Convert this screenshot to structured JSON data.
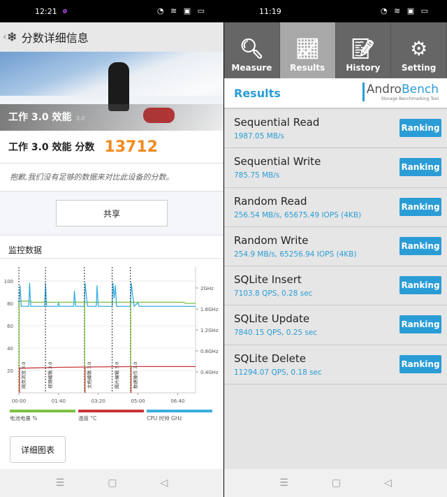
{
  "left": {
    "status": {
      "time": "12:21"
    },
    "appbar": {
      "title": "分数详细信息"
    },
    "hero": {
      "title": "工作 3.0 效能",
      "version": "3.0"
    },
    "score": {
      "label": "工作 3.0 效能 分数",
      "value": "13712"
    },
    "note": "抱歉,我们没有足够的数据来对比此设备的分数。",
    "share_label": "共享",
    "monitor_title": "监控数据",
    "detail_label": "详细图表",
    "chart_data": {
      "type": "line",
      "x_ticks": [
        "00:00",
        "01:40",
        "03:20",
        "05:00",
        "06:40"
      ],
      "y_ticks": [
        20,
        40,
        60,
        80,
        100
      ],
      "y2_ticks": [
        "0.4GHz",
        "0.8GHz",
        "1.2GHz",
        "1.6GHz",
        "2GHz"
      ],
      "markers": [
        {
          "x": "00:00",
          "label": "网页浏览 3.0"
        },
        {
          "x": "01:07",
          "label": "视频编辑 3.0"
        },
        {
          "x": "02:45",
          "label": "文档编辑 3.0"
        },
        {
          "x": "03:55",
          "label": "图片编辑 3.0"
        },
        {
          "x": "04:41",
          "label": "数据操作 3.0"
        }
      ],
      "series": [
        {
          "name": "电池电量 %",
          "color": "#7cc143",
          "points": [
            [
              "00:00",
              82
            ],
            [
              "00:30",
              82
            ],
            [
              "00:32",
              81
            ],
            [
              "06:55",
              81
            ],
            [
              "07:00",
              80
            ],
            [
              "07:25",
              80
            ]
          ]
        },
        {
          "name": "温度 °C",
          "color": "#c8363a",
          "points": [
            [
              "00:00",
              22
            ],
            [
              "01:40",
              22.8
            ],
            [
              "03:20",
              23.2
            ],
            [
              "05:00",
              23.5
            ],
            [
              "07:25",
              23.5
            ]
          ]
        },
        {
          "name": "CPU 时钟 GHz",
          "color": "#3aaee0",
          "points": [
            [
              "00:00",
              1.65
            ],
            [
              "00:03",
              2.05
            ],
            [
              "00:06",
              1.65
            ],
            [
              "00:25",
              1.65
            ],
            [
              "00:27",
              2.1
            ],
            [
              "00:30",
              1.65
            ],
            [
              "01:05",
              1.65
            ],
            [
              "01:07",
              2.1
            ],
            [
              "01:10",
              1.65
            ],
            [
              "01:38",
              1.65
            ],
            [
              "01:40",
              1.72
            ],
            [
              "01:42",
              1.65
            ],
            [
              "02:18",
              1.65
            ],
            [
              "02:20",
              1.95
            ],
            [
              "02:23",
              1.65
            ],
            [
              "02:45",
              1.65
            ],
            [
              "02:47",
              2.1
            ],
            [
              "02:50",
              1.85
            ],
            [
              "02:53",
              1.65
            ],
            [
              "03:15",
              1.65
            ],
            [
              "03:17",
              2.05
            ],
            [
              "03:20",
              1.65
            ],
            [
              "03:55",
              1.65
            ],
            [
              "03:57",
              2.1
            ],
            [
              "04:00",
              1.8
            ],
            [
              "04:03",
              2.05
            ],
            [
              "04:06",
              1.65
            ],
            [
              "04:41",
              1.65
            ],
            [
              "04:43",
              2.1
            ],
            [
              "04:46",
              1.9
            ],
            [
              "04:50",
              1.65
            ],
            [
              "05:00",
              1.72
            ],
            [
              "05:03",
              1.65
            ],
            [
              "07:25",
              1.65
            ]
          ]
        }
      ]
    }
  },
  "right": {
    "status": {
      "time": "11:19"
    },
    "tabs": [
      {
        "label": "Measure",
        "icon": "search-icon"
      },
      {
        "label": "Results",
        "icon": "chart-icon"
      },
      {
        "label": "History",
        "icon": "document-icon"
      },
      {
        "label": "Setting",
        "icon": "gear-icon"
      }
    ],
    "header": {
      "title": "Results",
      "brand_a": "Andro",
      "brand_b": "Bench",
      "brand_sub": "Storage Benchmarking Tool"
    },
    "ranking_label": "Ranking",
    "results": [
      {
        "name": "Sequential Read",
        "value": "1987.05 MB/s"
      },
      {
        "name": "Sequential Write",
        "value": "785.75 MB/s"
      },
      {
        "name": "Random Read",
        "value": "256.54 MB/s, 65675.49 IOPS (4KB)"
      },
      {
        "name": "Random Write",
        "value": "254.9 MB/s, 65256.94 IOPS (4KB)"
      },
      {
        "name": "SQLite Insert",
        "value": "7103.8 QPS, 0.28 sec"
      },
      {
        "name": "SQLite Update",
        "value": "7840.15 QPS, 0.25 sec"
      },
      {
        "name": "SQLite Delete",
        "value": "11294.07 QPS, 0.18 sec"
      }
    ]
  }
}
